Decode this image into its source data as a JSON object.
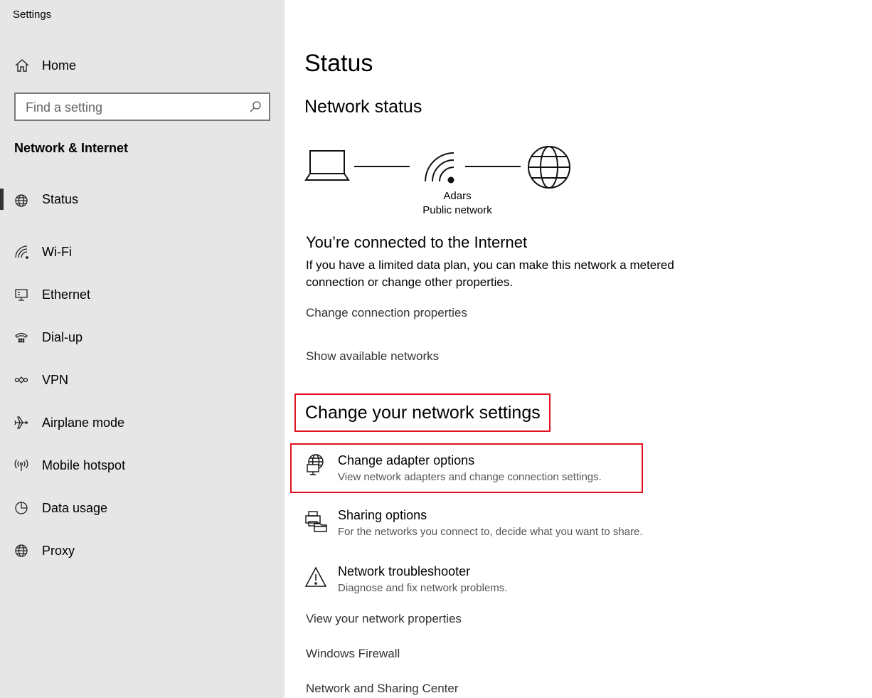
{
  "window": {
    "title": "Settings"
  },
  "sidebar": {
    "home_label": "Home",
    "search_placeholder": "Find a setting",
    "section_title": "Network & Internet",
    "items": [
      {
        "label": "Status",
        "icon": "globe-status-icon",
        "active": true
      },
      {
        "label": "Wi-Fi",
        "icon": "wifi-icon"
      },
      {
        "label": "Ethernet",
        "icon": "ethernet-icon"
      },
      {
        "label": "Dial-up",
        "icon": "dialup-icon"
      },
      {
        "label": "VPN",
        "icon": "vpn-icon"
      },
      {
        "label": "Airplane mode",
        "icon": "airplane-icon"
      },
      {
        "label": "Mobile hotspot",
        "icon": "hotspot-icon"
      },
      {
        "label": "Data usage",
        "icon": "data-usage-icon"
      },
      {
        "label": "Proxy",
        "icon": "globe-icon"
      }
    ]
  },
  "main": {
    "title": "Status",
    "network_status_heading": "Network status",
    "network": {
      "name": "Adars",
      "type": "Public network"
    },
    "connected_heading": "You’re connected to the Internet",
    "connected_desc": "If you have a limited data plan, you can make this network a metered connection or change other properties.",
    "links_top": [
      "Change connection properties",
      "Show available networks"
    ],
    "settings_heading": "Change your network settings",
    "options": [
      {
        "name": "Change adapter options",
        "desc": "View network adapters and change connection settings.",
        "icon": "adapter-icon"
      },
      {
        "name": "Sharing options",
        "desc": "For the networks you connect to, decide what you want to share.",
        "icon": "sharing-icon"
      },
      {
        "name": "Network troubleshooter",
        "desc": "Diagnose and fix network problems.",
        "icon": "warning-icon"
      }
    ],
    "links_bottom": [
      "View your network properties",
      "Windows Firewall",
      "Network and Sharing Center"
    ],
    "highlight_color": "#e0121f"
  }
}
